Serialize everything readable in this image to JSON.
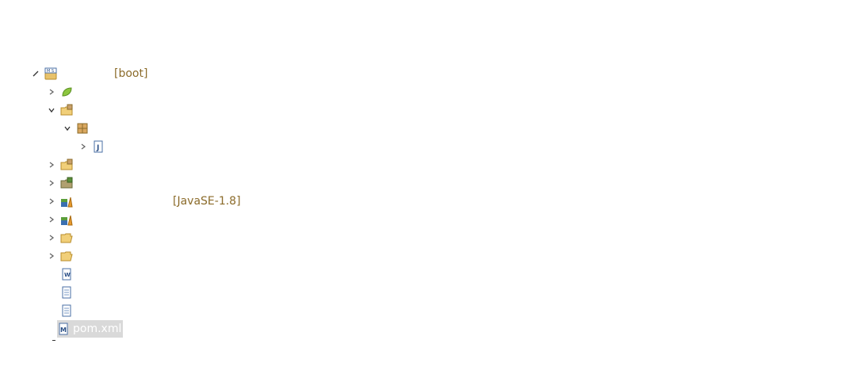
{
  "tree": {
    "root": {
      "label": "",
      "decoration": "[boot]",
      "icon": "maven-spring-project-icon",
      "expanded": true
    },
    "rows": [
      {
        "icon": "spring-leaf-icon",
        "label": "",
        "decoration": "",
        "expanded": false
      },
      {
        "icon": "source-folder-icon",
        "label": "",
        "decoration": "",
        "expanded": true
      },
      {
        "icon": "package-icon",
        "label": "",
        "decoration": "",
        "expanded": true
      },
      {
        "icon": "java-file-icon",
        "label": "",
        "decoration": "",
        "expanded": false
      },
      {
        "icon": "source-folder-icon",
        "label": "",
        "decoration": "",
        "expanded": false
      },
      {
        "icon": "resource-folder-icon",
        "label": "",
        "decoration": "",
        "expanded": false
      },
      {
        "icon": "library-icon",
        "label": "",
        "decoration": "[JavaSE-1.8]",
        "expanded": false
      },
      {
        "icon": "library-icon",
        "label": "",
        "decoration": "",
        "expanded": false
      },
      {
        "icon": "folder-icon",
        "label": "",
        "decoration": "",
        "expanded": false
      },
      {
        "icon": "folder-icon",
        "label": "",
        "decoration": "",
        "expanded": false
      },
      {
        "icon": "word-file-icon",
        "label": "",
        "decoration": ""
      },
      {
        "icon": "text-file-icon",
        "label": "",
        "decoration": ""
      },
      {
        "icon": "text-file-icon",
        "label": "",
        "decoration": ""
      },
      {
        "icon": "maven-pom-icon",
        "label": "pom.xml",
        "decoration": "",
        "selected": true
      }
    ]
  }
}
